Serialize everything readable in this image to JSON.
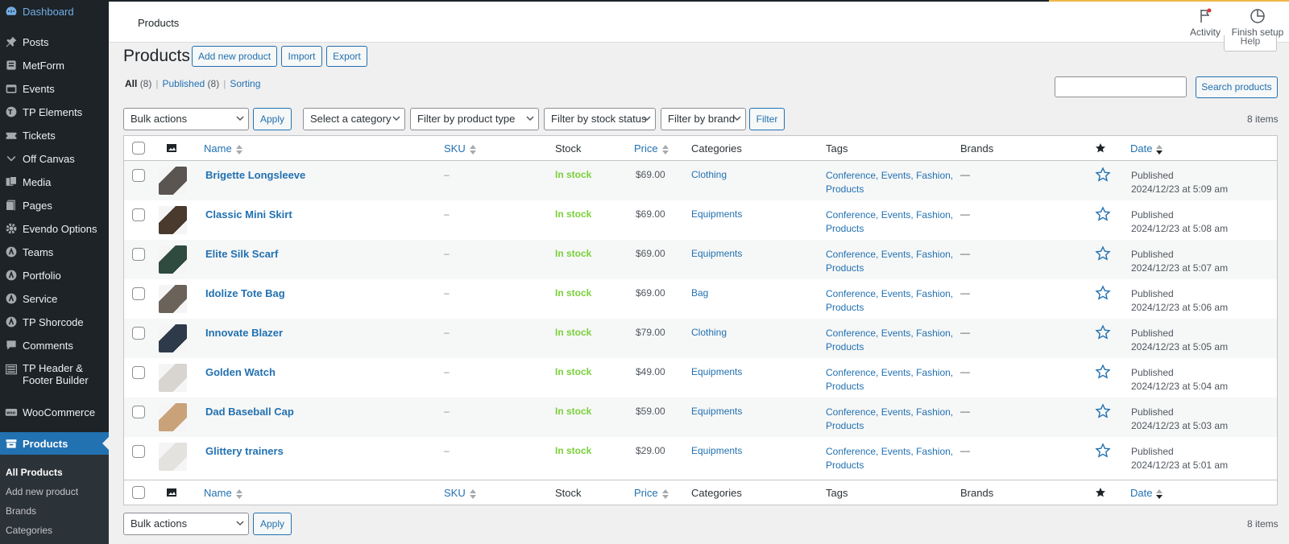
{
  "sidebar": {
    "items": [
      {
        "label": "Dashboard",
        "icon": "dashboard-icon"
      },
      {
        "label": "Posts",
        "icon": "pin-icon"
      },
      {
        "label": "MetForm",
        "icon": "form-icon"
      },
      {
        "label": "Events",
        "icon": "events-icon"
      },
      {
        "label": "TP Elements",
        "icon": "tp-icon"
      },
      {
        "label": "Tickets",
        "icon": "ticket-icon"
      },
      {
        "label": "Off Canvas",
        "icon": "chevron-down-icon"
      },
      {
        "label": "Media",
        "icon": "media-icon"
      },
      {
        "label": "Pages",
        "icon": "pages-icon"
      },
      {
        "label": "Evendo Options",
        "icon": "gear-icon"
      },
      {
        "label": "Teams",
        "icon": "circle-icon"
      },
      {
        "label": "Portfolio",
        "icon": "circle-icon"
      },
      {
        "label": "Service",
        "icon": "circle-icon"
      },
      {
        "label": "TP Shorcode",
        "icon": "circle-icon"
      },
      {
        "label": "Comments",
        "icon": "comment-icon"
      },
      {
        "label": "TP Header & Footer Builder",
        "icon": "builder-icon"
      },
      {
        "label": "WooCommerce",
        "icon": "woo-icon"
      },
      {
        "label": "Products",
        "icon": "archive-icon"
      }
    ],
    "submenu": [
      "All Products",
      "Add new product",
      "Brands",
      "Categories"
    ]
  },
  "header": {
    "title": "Products",
    "activity_label": "Activity",
    "finish_setup_label": "Finish setup",
    "help_label": "Help"
  },
  "page": {
    "title": "Products",
    "add_new_label": "Add new product",
    "import_label": "Import",
    "export_label": "Export"
  },
  "views": {
    "all_label": "All",
    "all_count": "(8)",
    "published_label": "Published",
    "published_count": "(8)",
    "sorting_label": "Sorting"
  },
  "search": {
    "value": "",
    "button_label": "Search products"
  },
  "filters": {
    "bulk_actions": "Bulk actions",
    "apply_label": "Apply",
    "category": "Select a category",
    "product_type": "Filter by product type",
    "stock_status": "Filter by stock status",
    "brand": "Filter by brand",
    "filter_label": "Filter",
    "items_count": "8 items"
  },
  "table": {
    "columns": {
      "name": "Name",
      "sku": "SKU",
      "stock": "Stock",
      "price": "Price",
      "categories": "Categories",
      "tags": "Tags",
      "brands": "Brands",
      "date": "Date"
    },
    "rows": [
      {
        "name": "Brigette Longsleeve",
        "sku": "–",
        "stock": "In stock",
        "price": "$69.00",
        "category": "Clothing",
        "tags": [
          "Conference,",
          "Events,",
          "Fashion,",
          "Products"
        ],
        "brand": "—",
        "status": "Published",
        "date": "2024/12/23 at 5:09 am",
        "thumb": "#5a5550"
      },
      {
        "name": "Classic Mini Skirt",
        "sku": "–",
        "stock": "In stock",
        "price": "$69.00",
        "category": "Equipments",
        "tags": [
          "Conference,",
          "Events,",
          "Fashion,",
          "Products"
        ],
        "brand": "—",
        "status": "Published",
        "date": "2024/12/23 at 5:08 am",
        "thumb": "#4a3a2e"
      },
      {
        "name": "Elite Silk Scarf",
        "sku": "–",
        "stock": "In stock",
        "price": "$69.00",
        "category": "Equipments",
        "tags": [
          "Conference,",
          "Events,",
          "Fashion,",
          "Products"
        ],
        "brand": "—",
        "status": "Published",
        "date": "2024/12/23 at 5:07 am",
        "thumb": "#2f4a3e"
      },
      {
        "name": "Idolize Tote Bag",
        "sku": "–",
        "stock": "In stock",
        "price": "$69.00",
        "category": "Bag",
        "tags": [
          "Conference,",
          "Events,",
          "Fashion,",
          "Products"
        ],
        "brand": "—",
        "status": "Published",
        "date": "2024/12/23 at 5:06 am",
        "thumb": "#6b625a"
      },
      {
        "name": "Innovate Blazer",
        "sku": "–",
        "stock": "In stock",
        "price": "$79.00",
        "category": "Clothing",
        "tags": [
          "Conference,",
          "Events,",
          "Fashion,",
          "Products"
        ],
        "brand": "—",
        "status": "Published",
        "date": "2024/12/23 at 5:05 am",
        "thumb": "#2e3a4a"
      },
      {
        "name": "Golden Watch",
        "sku": "–",
        "stock": "In stock",
        "price": "$49.00",
        "category": "Equipments",
        "tags": [
          "Conference,",
          "Events,",
          "Fashion,",
          "Products"
        ],
        "brand": "—",
        "status": "Published",
        "date": "2024/12/23 at 5:04 am",
        "thumb": "#d8d4d0"
      },
      {
        "name": "Dad Baseball Cap",
        "sku": "–",
        "stock": "In stock",
        "price": "$59.00",
        "category": "Equipments",
        "tags": [
          "Conference,",
          "Events,",
          "Fashion,",
          "Products"
        ],
        "brand": "—",
        "status": "Published",
        "date": "2024/12/23 at 5:03 am",
        "thumb": "#c9a27a"
      },
      {
        "name": "Glittery trainers",
        "sku": "–",
        "stock": "In stock",
        "price": "$29.00",
        "category": "Equipments",
        "tags": [
          "Conference,",
          "Events,",
          "Fashion,",
          "Products"
        ],
        "brand": "—",
        "status": "Published",
        "date": "2024/12/23 at 5:01 am",
        "thumb": "#e4e2de"
      }
    ]
  },
  "bottom": {
    "bulk_actions": "Bulk actions",
    "apply_label": "Apply",
    "items_count": "8 items"
  },
  "colors": {
    "sidebar_bg": "#1d2327",
    "accent": "#2271b1",
    "in_stock": "#7ad03a",
    "progress": "#f0b849"
  }
}
